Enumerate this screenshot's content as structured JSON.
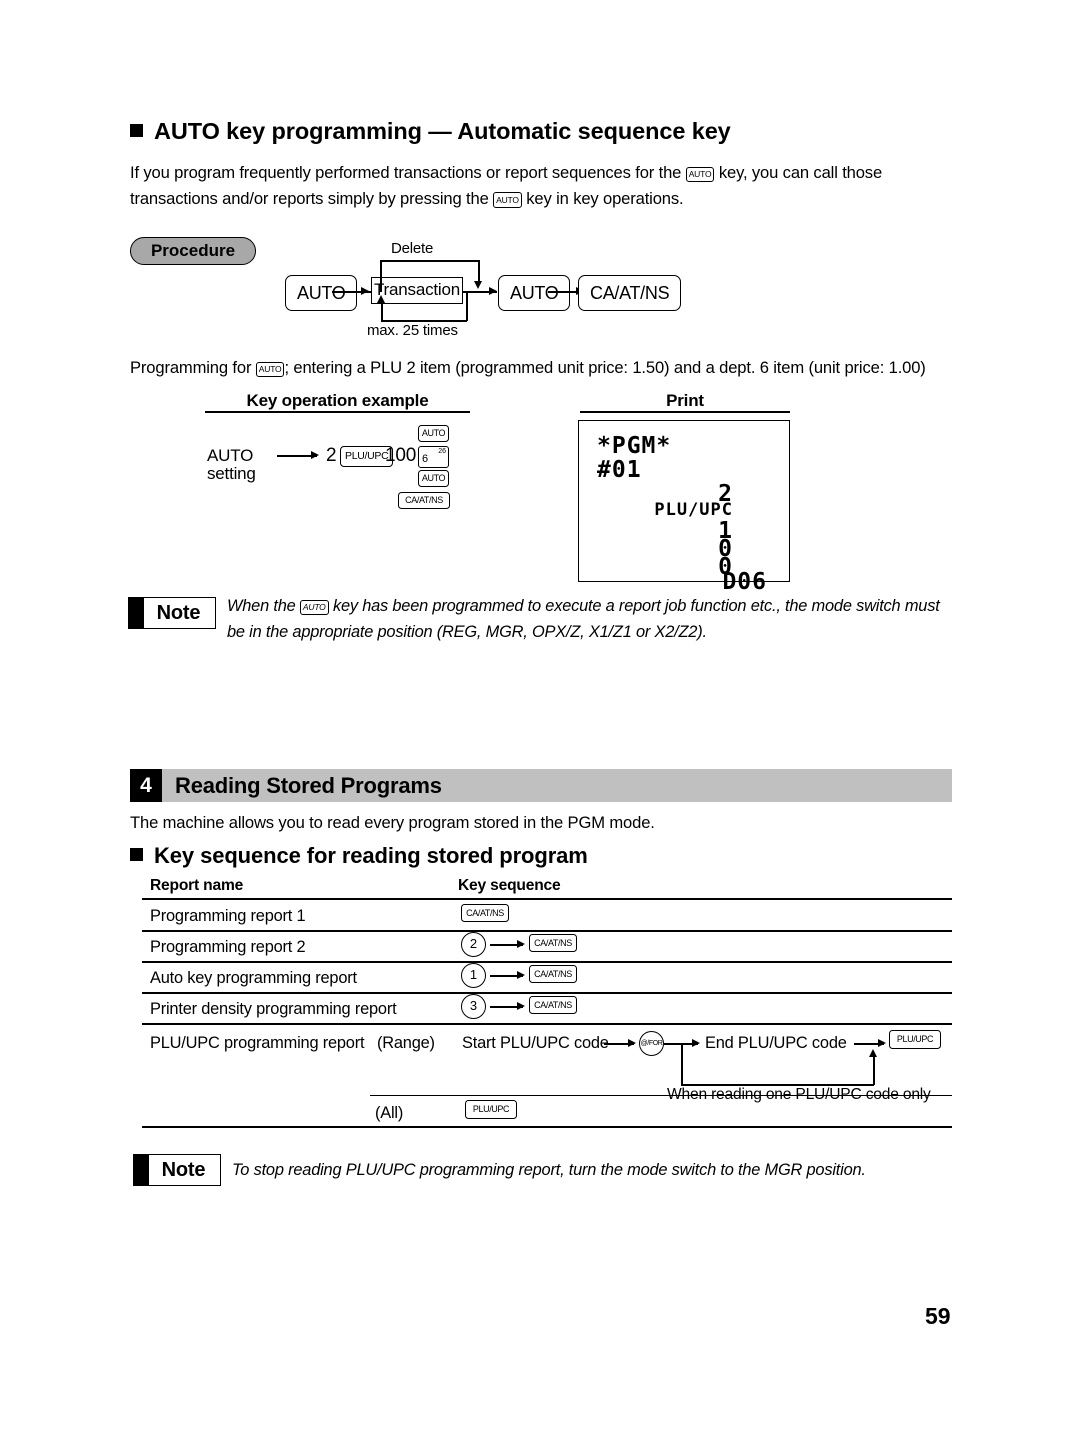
{
  "section_auto": {
    "heading": "AUTO key programming — Automatic sequence key",
    "intro_1a": "If you program frequently performed transactions or report sequences for the",
    "intro_key1": "AUTO",
    "intro_1b": "key, you can call those",
    "intro_2a": "transactions and/or reports simply by pressing the",
    "intro_key2": "AUTO",
    "intro_2b": "key in key operations.",
    "procedure_label": "Procedure",
    "diagram": {
      "key_auto_start": "AUTO",
      "transaction_box": "Transaction",
      "delete_label": "Delete",
      "max_label": "max. 25 times",
      "key_auto_end": "AUTO",
      "key_caatns": "CA/AT/NS"
    },
    "example_caption_a": "Programming for",
    "example_caption_key": "AUTO",
    "example_caption_b": "; entering a PLU 2 item (programmed unit price: 1.50) and a dept. 6 item (unit price: 1.00)",
    "col_key_operation": "Key operation example",
    "col_print": "Print",
    "key_op": {
      "label_line1": "AUTO",
      "label_line2": "setting",
      "digit_2": "2",
      "key_plu_upc": "PLU/UPC",
      "digit_100": "100",
      "key_dept_main": "6",
      "key_dept_sup": "26",
      "key_auto_top": "AUTO",
      "key_auto_mid": "AUTO",
      "key_caatns": "CA/AT/NS"
    },
    "receipt": {
      "line_pgm": "*PGM*",
      "line_num": "#01",
      "right_lines": [
        "2",
        "PLU/UPC",
        "1",
        "0",
        "0",
        "D06"
      ]
    },
    "note": {
      "label": "Note",
      "text_a": "When the",
      "key": "AUTO",
      "text_b": "key has been programmed to execute a report job function etc., the mode switch",
      "text_c": "must be in the appropriate position (REG, MGR, OPX/Z, X1/Z1 or X2/Z2)."
    }
  },
  "section_reading": {
    "number": "4",
    "title": "Reading Stored Programs",
    "intro": "The machine allows you to read every program stored in the PGM mode.",
    "subheading": "Key sequence for reading stored program",
    "table": {
      "header_report_name": "Report name",
      "header_key_sequence": "Key sequence",
      "rows": [
        {
          "name": "Programming report 1",
          "circle": "",
          "key": "CA/AT/NS"
        },
        {
          "name": "Programming report 2",
          "circle": "2",
          "key": "CA/AT/NS"
        },
        {
          "name": "Auto key programming report",
          "circle": "1",
          "key": "CA/AT/NS"
        },
        {
          "name": "Printer density programming report",
          "circle": "3",
          "key": "CA/AT/NS"
        }
      ],
      "plu_row": {
        "name": "PLU/UPC programming report",
        "range_label": "(Range)",
        "start_text": "Start PLU/UPC code",
        "circle_key": "@/FOR",
        "end_text": "End PLU/UPC code",
        "end_key": "PLU/UPC",
        "branch_note": "When reading one PLU/UPC code only",
        "all_label": "(All)",
        "all_key": "PLU/UPC"
      }
    },
    "note": {
      "label": "Note",
      "text": "To stop reading PLU/UPC programming report, turn the mode switch to the MGR position."
    }
  },
  "page_number": "59"
}
